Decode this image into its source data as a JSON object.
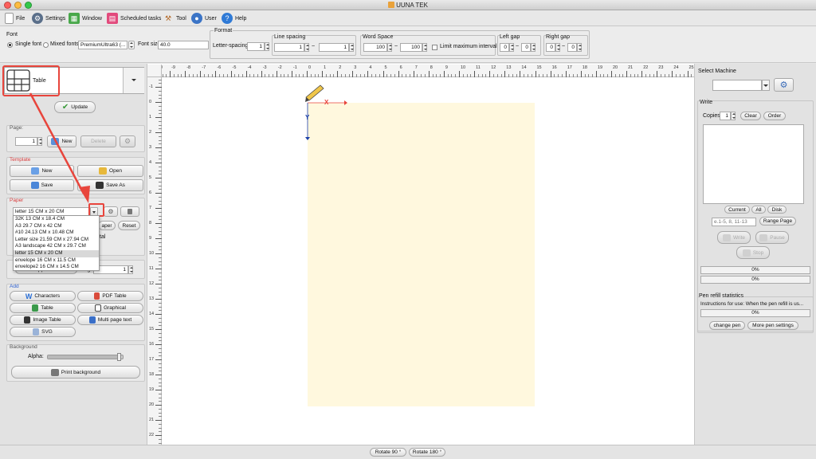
{
  "window": {
    "title": "UUNA TEK"
  },
  "menu": [
    {
      "label": "File",
      "icon": "file-icon"
    },
    {
      "label": "Settings",
      "icon": "gear-icon"
    },
    {
      "label": "Window",
      "icon": "window-icon"
    },
    {
      "label": "Scheduled tasks",
      "icon": "calendar-icon"
    },
    {
      "label": "Tool",
      "icon": "hammer-icon"
    },
    {
      "label": "User",
      "icon": "user-icon"
    },
    {
      "label": "Help",
      "icon": "help-icon"
    }
  ],
  "font": {
    "group_label": "Font",
    "single_label": "Single font",
    "mixed_label": "Mixed fonts",
    "font_value": "PremiumUltra63 (...",
    "size_label": "Font size",
    "size_value": "40.0"
  },
  "format": {
    "group_label": "Format",
    "letter_spacing_label": "Letter-spacing",
    "letter_spacing_value": "1",
    "line_spacing_label": "Line spacing",
    "line_from": "1",
    "line_to": "1",
    "tilde": "~",
    "word_space_label": "Word Space",
    "word_from": "100",
    "word_to": "100",
    "limit_label": "Limit maximum interval",
    "left_gap_label": "Left gap",
    "left_from": "0",
    "left_to": "0",
    "right_gap_label": "Right gap",
    "right_from": "0",
    "right_to": "0"
  },
  "template_select": {
    "value": "Table"
  },
  "update_label": "Update",
  "page": {
    "label": "Page:",
    "value": "1",
    "new_label": "New",
    "delete_label": "Delete"
  },
  "template": {
    "label": "Template",
    "new_label": "New",
    "open_label": "Open",
    "save_label": "Save",
    "save_as_label": "Save As"
  },
  "paper": {
    "label": "Paper",
    "selected": "letter 15 CM x 20 CM",
    "options": [
      "32K 13 CM x 18.4 CM",
      "A3 29.7 CM x 42 CM",
      "#10 24.13 CM x 10.48 CM",
      "Letter size 21.59 CM x 27.94 CM",
      "A3 landscape 42 CM x 29.7 CM",
      "letter 15 CM x 20 CM",
      "envelope 16 CM x 11.5 CM",
      "envelope2 16 CM x 14.5 CM"
    ],
    "selected_index": 5,
    "paper_btn": "aper",
    "reset_label": "Reset",
    "partial_label": "tal"
  },
  "batch": {
    "label": "Batch application data",
    "page_label": "Page",
    "page_value": "1"
  },
  "add": {
    "label": "Add",
    "characters": "Characters",
    "pdf_table": "PDF Table",
    "table": "Table",
    "graphical": "Graphical",
    "image_table": "Image Table",
    "multi_page_text": "Multi page text",
    "svg": "SVG"
  },
  "background": {
    "label": "Background",
    "alpha_label": "Alpha:",
    "alpha_level": 0.97,
    "print_label": "Print background"
  },
  "ruler": {
    "top_ticks": [
      "-10",
      "-9",
      "-8",
      "-7",
      "-6",
      "-5",
      "-4",
      "-3",
      "-2",
      "-1",
      "0",
      "1",
      "2",
      "3",
      "4",
      "5",
      "6",
      "7",
      "8",
      "9",
      "10",
      "11",
      "12",
      "13",
      "14",
      "15",
      "16",
      "17",
      "18",
      "19",
      "20",
      "21",
      "22",
      "23",
      "24",
      "25"
    ],
    "left_ticks": [
      "-2",
      "-1",
      "0",
      "1",
      "2",
      "3",
      "4",
      "5",
      "6",
      "7",
      "8",
      "9",
      "10",
      "11",
      "12",
      "13",
      "14",
      "15",
      "16",
      "17",
      "18",
      "19",
      "20",
      "21",
      "22"
    ]
  },
  "origin": {
    "x_label": "X",
    "y_label": "Y"
  },
  "machine": {
    "label": "Select Machine"
  },
  "write": {
    "label": "Write",
    "copies_label": "Copies",
    "copies_value": "1",
    "clear_label": "Clear",
    "order_label": "Order",
    "current_label": "Current",
    "all_label": "All",
    "disk_label": "Disk",
    "range_placeholder": "e.1-5, 8, 11-13",
    "range_page_label": "Range Page",
    "write_label": "Write",
    "pause_label": "Pause",
    "stop_label": "Stop",
    "progress1": "0%",
    "progress2": "0%"
  },
  "pen": {
    "label": "Pen refill statistics",
    "instructions": "Instructions for use: When the pen refill is us...",
    "progress": "0%",
    "change_label": "change pen",
    "more_label": "More pen settings"
  },
  "bottom": {
    "rotate90": "Rotate 90 °",
    "rotate180": "Rotate 180 °"
  },
  "colors": {
    "paper": "#fff8de",
    "accent_red": "#e8453c",
    "axis_blue": "#1a3fa8"
  }
}
